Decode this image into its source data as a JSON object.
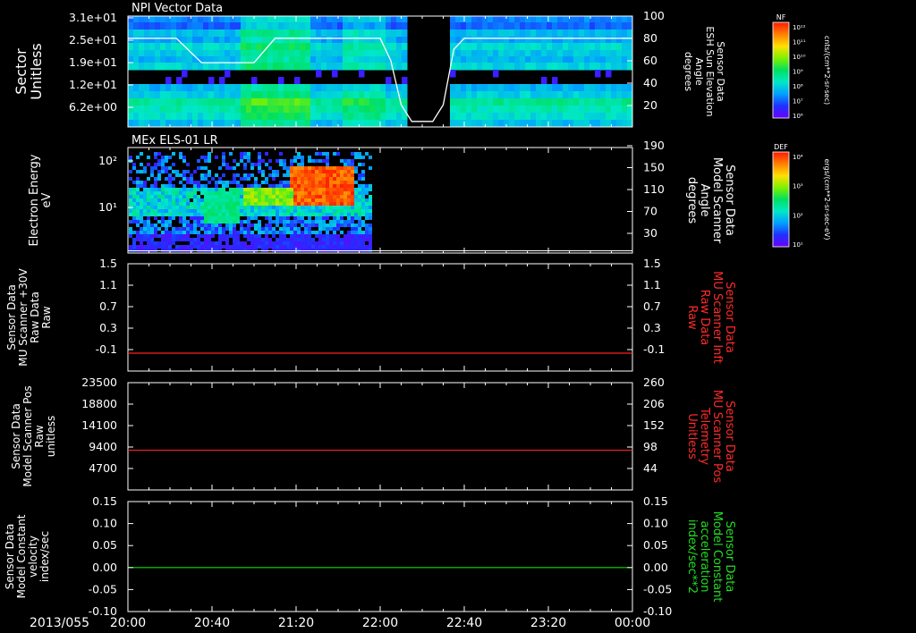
{
  "date_label": "2013/055",
  "time_ticks": [
    "20:00",
    "20:40",
    "21:20",
    "22:00",
    "22:40",
    "23:20",
    "00:00"
  ],
  "colors": {
    "background": "#000000",
    "axis": "#ffffff",
    "red_trace": "#ff2020",
    "green_trace": "#00e000",
    "red_label": "#ff2a2a",
    "green_label": "#22dd22",
    "colorbar": [
      "#6a00ff",
      "#2030ff",
      "#00a0ff",
      "#00e8c8",
      "#00e060",
      "#80f000",
      "#ffe000",
      "#ff8000",
      "#ff1a00"
    ]
  },
  "colorbars": [
    {
      "top_label": "NF",
      "tick_labels": [
        "10¹²",
        "10¹¹",
        "10¹⁰",
        "10⁹",
        "10⁸",
        "10⁷",
        "10⁶"
      ],
      "unit_label": "cnts/(cm**2-sr-sec)"
    },
    {
      "top_label": "DEF",
      "tick_labels": [
        "10⁴",
        "10³",
        "10²",
        "10¹"
      ],
      "unit_label": "ergs/(cm**2-sr-sec-eV)"
    }
  ],
  "chart_data": [
    {
      "type": "heatmap",
      "title": "NPI Vector Data",
      "ylabel": [
        "Sector",
        "Unitless"
      ],
      "y_tick_labels": [
        "3.1e+01",
        "2.5e+01",
        "1.9e+01",
        "1.2e+01",
        "6.2e+00"
      ],
      "right_ylabel": [
        "Sensor Data",
        "ESH Sun Elevation",
        "Angle",
        "degrees"
      ],
      "right_y_ticks": [
        100,
        80,
        60,
        40,
        20
      ],
      "right_ylim": [
        0,
        100
      ],
      "data_gap": {
        "start": "22:13",
        "end": "22:33"
      },
      "overlay_line": {
        "x": [
          "20:00",
          "20:23",
          "20:35",
          "21:00",
          "21:10",
          "22:00",
          "22:05",
          "22:10",
          "22:15",
          "22:25",
          "22:30",
          "22:35",
          "22:40",
          "24:00"
        ],
        "y": [
          80,
          80,
          58,
          58,
          80,
          80,
          60,
          20,
          5,
          5,
          20,
          70,
          80,
          80
        ]
      }
    },
    {
      "type": "heatmap",
      "title": "MEx ELS-01 LR",
      "ylabel": [
        "Electron Energy",
        "eV"
      ],
      "y_tick_labels": [
        "10²",
        "10¹"
      ],
      "right_ylabel": [
        "Sensor Data",
        "Model Scanner",
        "Angle",
        "degrees"
      ],
      "right_y_ticks": [
        190,
        150,
        110,
        70,
        30
      ],
      "right_ylim": [
        0,
        190
      ],
      "data_end": "21:55",
      "overlay_line": {
        "x": [
          "20:00",
          "24:00"
        ],
        "y": [
          4,
          4
        ]
      }
    },
    {
      "type": "line",
      "ylabel": [
        "Sensor Data",
        "MU Scanner +30V",
        "Raw Data",
        "Raw"
      ],
      "y_tick_labels": [
        "1.5",
        "1.1",
        "0.7",
        "0.3",
        "-0.1"
      ],
      "ylim": [
        -0.3,
        1.5
      ],
      "right_ylabel": [
        "Sensor Data",
        "MU Scanner Inft",
        "Raw Data",
        "Raw"
      ],
      "right_y_tick_labels": [
        "1.5",
        "1.1",
        "0.7",
        "0.3",
        "-0.1"
      ],
      "series": [
        {
          "x": [
            "20:00",
            "24:00"
          ],
          "values": [
            0,
            0
          ]
        }
      ]
    },
    {
      "type": "line",
      "ylabel": [
        "Sensor Data",
        "Model Scanner Pos",
        "Raw",
        "unitless"
      ],
      "y_tick_labels": [
        "23500",
        "18800",
        "14100",
        "9400",
        "4700"
      ],
      "ylim": [
        0,
        23500
      ],
      "right_ylabel": [
        "Sensor Data",
        "MU Scanner Pos",
        "Telemetry",
        "Unitless"
      ],
      "right_y_tick_labels": [
        "260",
        "206",
        "152",
        "98",
        "44"
      ],
      "series": [
        {
          "x": [
            "20:00",
            "24:00"
          ],
          "values": [
            8700,
            8700
          ]
        }
      ]
    },
    {
      "type": "line",
      "ylabel": [
        "Sensor Data",
        "Model Constant",
        "velocity",
        "index/sec"
      ],
      "y_tick_labels": [
        "0.15",
        "0.10",
        "0.05",
        "0.00",
        "-0.05",
        "-0.10"
      ],
      "ylim": [
        -0.1,
        0.15
      ],
      "right_ylabel": [
        "Sensor Data",
        "Model Constant",
        "acceleration",
        "index/sec**2"
      ],
      "right_y_tick_labels": [
        "0.15",
        "0.10",
        "0.05",
        "0.00",
        "-0.05",
        "-0.10"
      ],
      "series": [
        {
          "x": [
            "20:00",
            "24:00"
          ],
          "values": [
            0,
            0
          ]
        }
      ]
    }
  ]
}
